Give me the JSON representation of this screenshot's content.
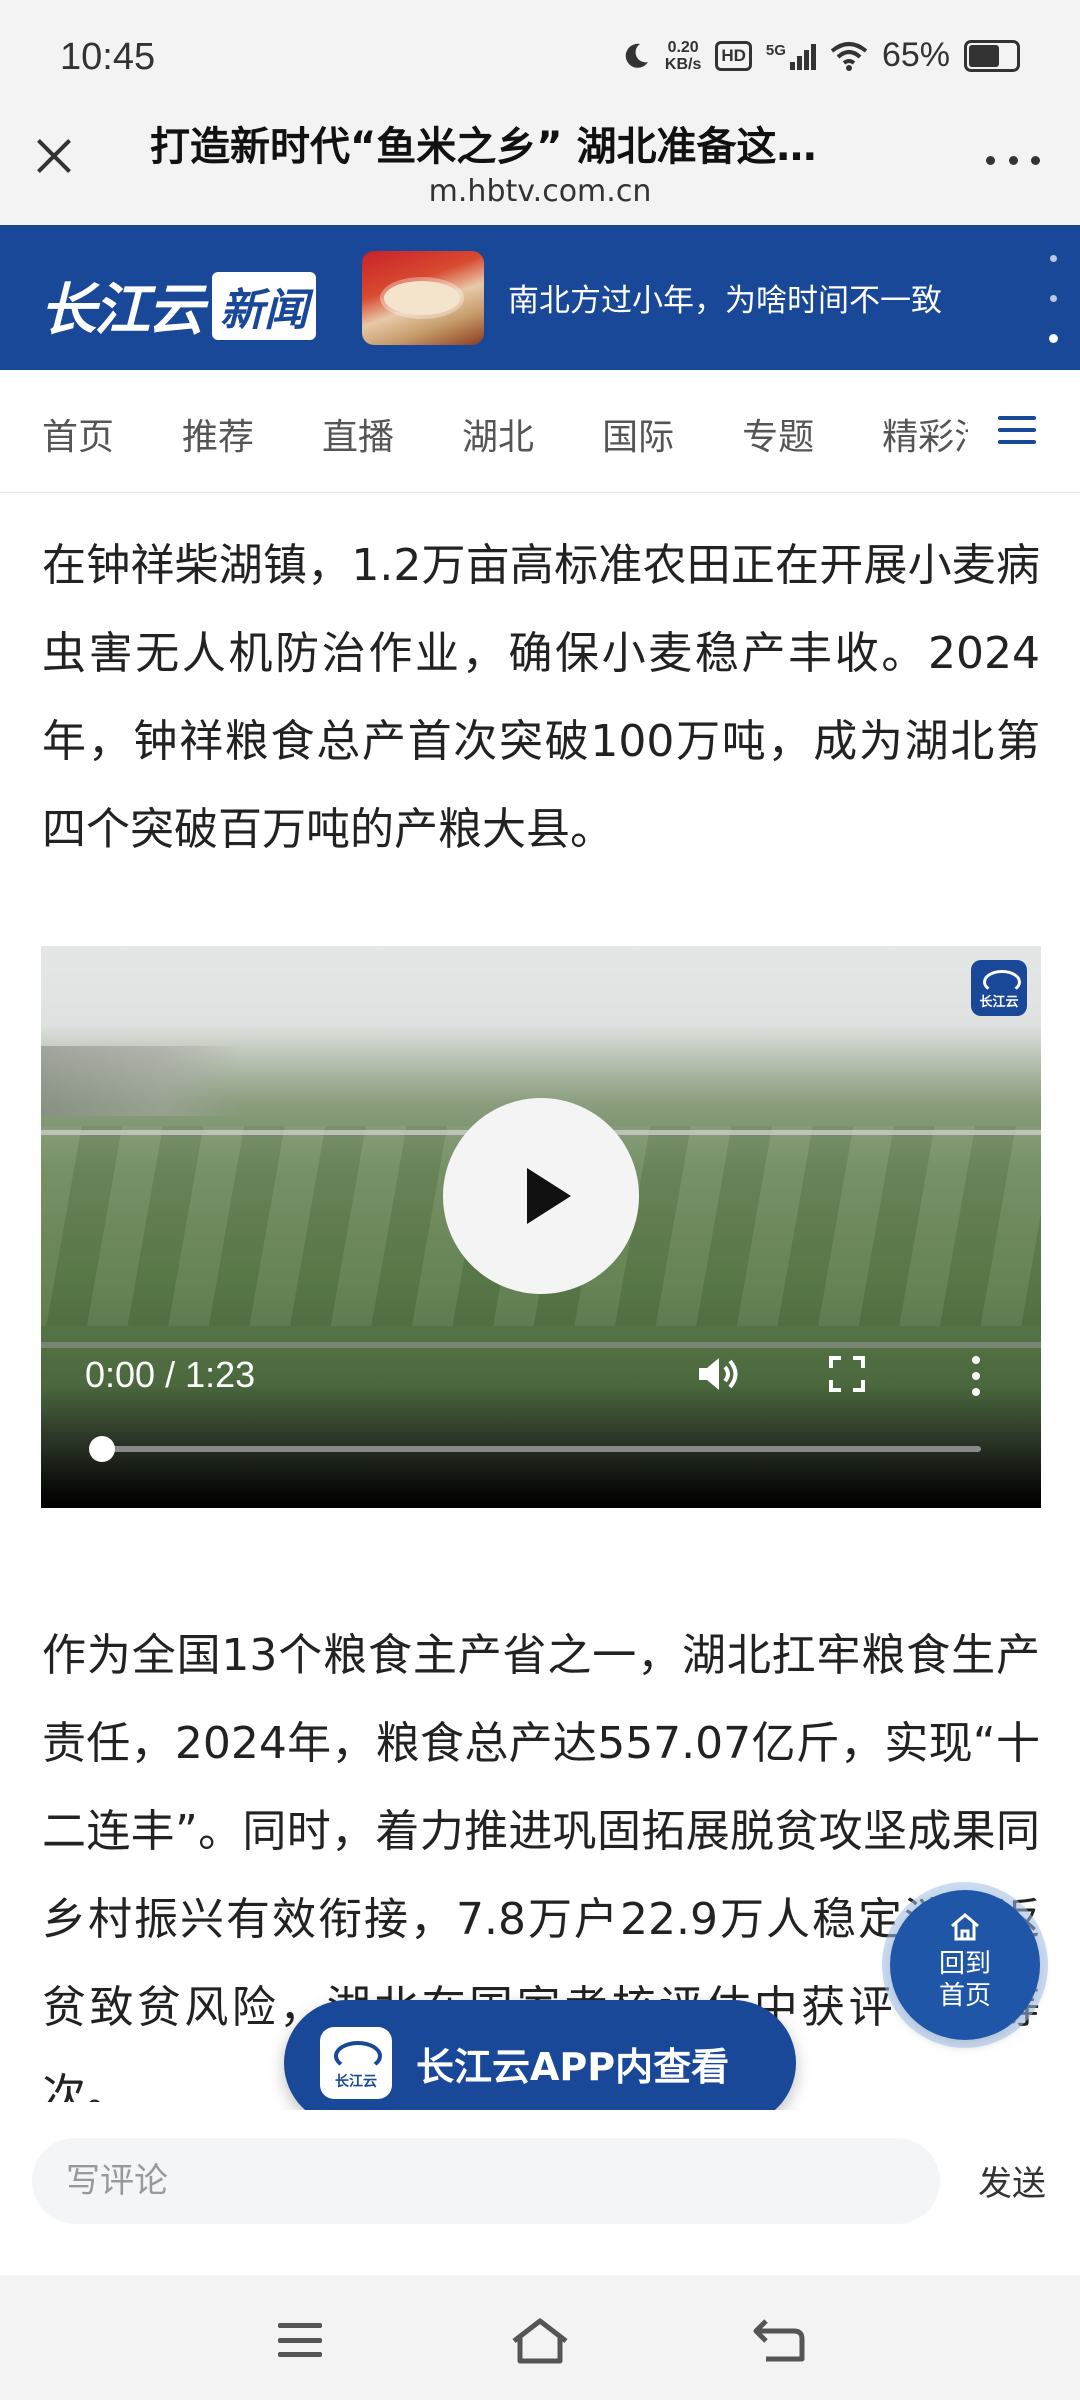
{
  "status_bar": {
    "time": "10:45",
    "net_speed_value": "0.20",
    "net_speed_unit": "KB/s",
    "hd": "HD",
    "network": "5G",
    "battery": "65%",
    "icons": [
      "moon-icon",
      "hd-icon",
      "signal-icon",
      "wifi-icon",
      "battery-icon"
    ]
  },
  "browser": {
    "title": "打造新时代“鱼米之乡” 湖北准备这…",
    "url": "m.hbtv.com.cn"
  },
  "banner": {
    "logo_text": "长江云",
    "logo_badge": "新闻",
    "headline": "南北方过小年，为啥时间不一致"
  },
  "nav": {
    "tabs": [
      {
        "label": "首页"
      },
      {
        "label": "推荐"
      },
      {
        "label": "直播"
      },
      {
        "label": "湖北"
      },
      {
        "label": "国际"
      },
      {
        "label": "专题"
      },
      {
        "label": "精彩活"
      }
    ]
  },
  "article": {
    "para1": "在钟祥柴湖镇，1.2万亩高标准农田正在开展小麦病虫害无人机防治作业，确保小麦稳产丰收。2024年，钟祥粮食总产首次突破100万吨，成为湖北第四个突破百万吨的产粮大县。",
    "para2": "作为全国13个粮食主产省之一，湖北扛牢粮食生产责任，2024年，粮食总产达557.07亿斤，实现“十二连丰”。同时，着力推进巩固拓展脱贫攻坚成果同乡村振兴有效衔接，7.8万户22.9万人稳定消除返贫致贫风险，湖北在国家考核评估中获评“好”等次。"
  },
  "video": {
    "time": "0:00 / 1:23",
    "progress": 0,
    "watermark": "长江云"
  },
  "floating": {
    "home_line1": "回到",
    "home_line2": "首页",
    "cta_logo": "长江云",
    "cta_text": "长江云APP内查看"
  },
  "comment": {
    "placeholder": "写评论",
    "send": "发送"
  },
  "colors": {
    "brand_blue": "#1a4898",
    "float_blue": "#1f56a8"
  }
}
